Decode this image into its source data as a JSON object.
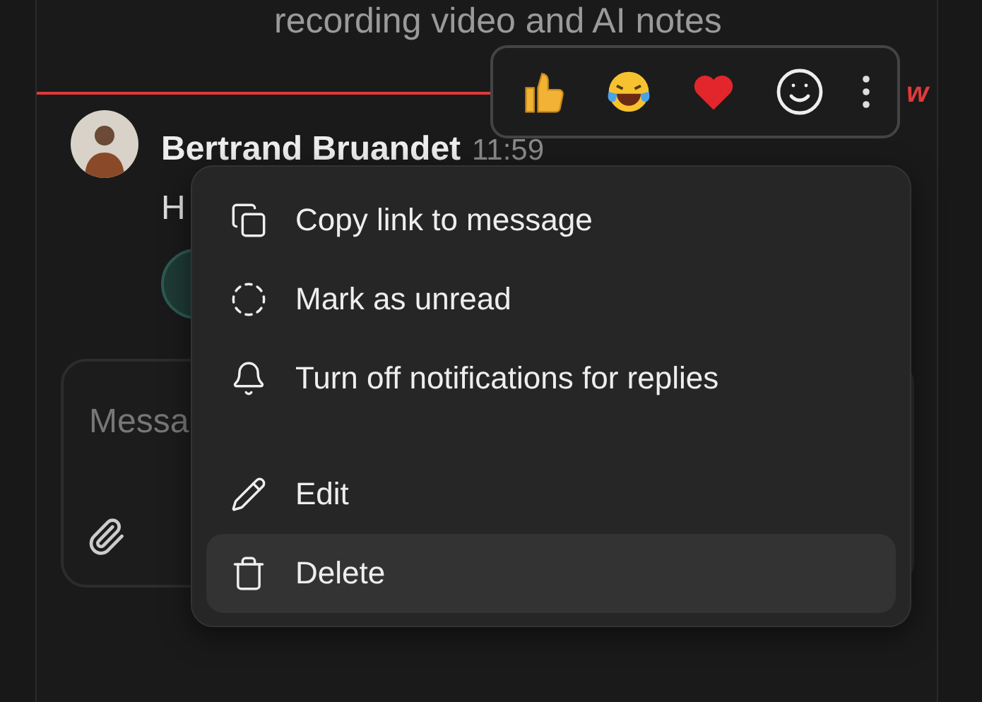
{
  "banner_text": "recording video and AI notes",
  "new_marker": "w",
  "message": {
    "author": "Bertrand Bruandet",
    "time": "11:59",
    "text": "H"
  },
  "composer": {
    "placeholder": "Messa"
  },
  "reactions": [
    {
      "kind": "thumbs"
    },
    {
      "kind": "laugh"
    },
    {
      "kind": "heart"
    },
    {
      "kind": "add"
    },
    {
      "kind": "more"
    }
  ],
  "menu": {
    "sections": [
      {
        "items": [
          {
            "kind": "copy",
            "label": "Copy link to message",
            "selected": false
          },
          {
            "kind": "unread",
            "label": "Mark as unread",
            "selected": false
          },
          {
            "kind": "bell",
            "label": "Turn off notifications for replies",
            "selected": false
          }
        ]
      },
      {
        "items": [
          {
            "kind": "edit",
            "label": "Edit",
            "selected": false
          },
          {
            "kind": "delete",
            "label": "Delete",
            "selected": true
          }
        ]
      }
    ]
  }
}
